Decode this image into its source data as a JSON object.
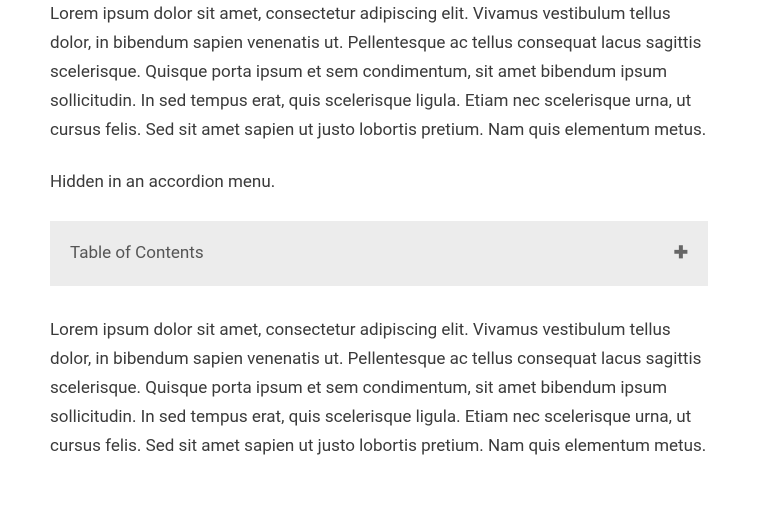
{
  "paragraph1": "Lorem ipsum dolor sit amet, consectetur adipiscing elit. Vivamus vestibulum tellus dolor, in bibendum sapien venenatis ut. Pellentesque ac tellus consequat lacus sagittis scelerisque. Quisque porta ipsum et sem condimentum, sit amet bibendum ipsum sollicitudin. In sed tempus erat, quis scelerisque ligula. Etiam nec scelerisque urna, ut cursus felis. Sed sit amet sapien ut justo lobortis pretium. Nam quis elementum metus.",
  "subtitle": "Hidden in an accordion menu.",
  "accordion": {
    "title": "Table of Contents",
    "icon": "✚"
  },
  "paragraph2": "Lorem ipsum dolor sit amet, consectetur adipiscing elit. Vivamus vestibulum tellus dolor, in bibendum sapien venenatis ut. Pellentesque ac tellus consequat lacus sagittis scelerisque. Quisque porta ipsum et sem condimentum, sit amet bibendum ipsum sollicitudin. In sed tempus erat, quis scelerisque ligula. Etiam nec scelerisque urna, ut cursus felis. Sed sit amet sapien ut justo lobortis pretium. Nam quis elementum metus."
}
